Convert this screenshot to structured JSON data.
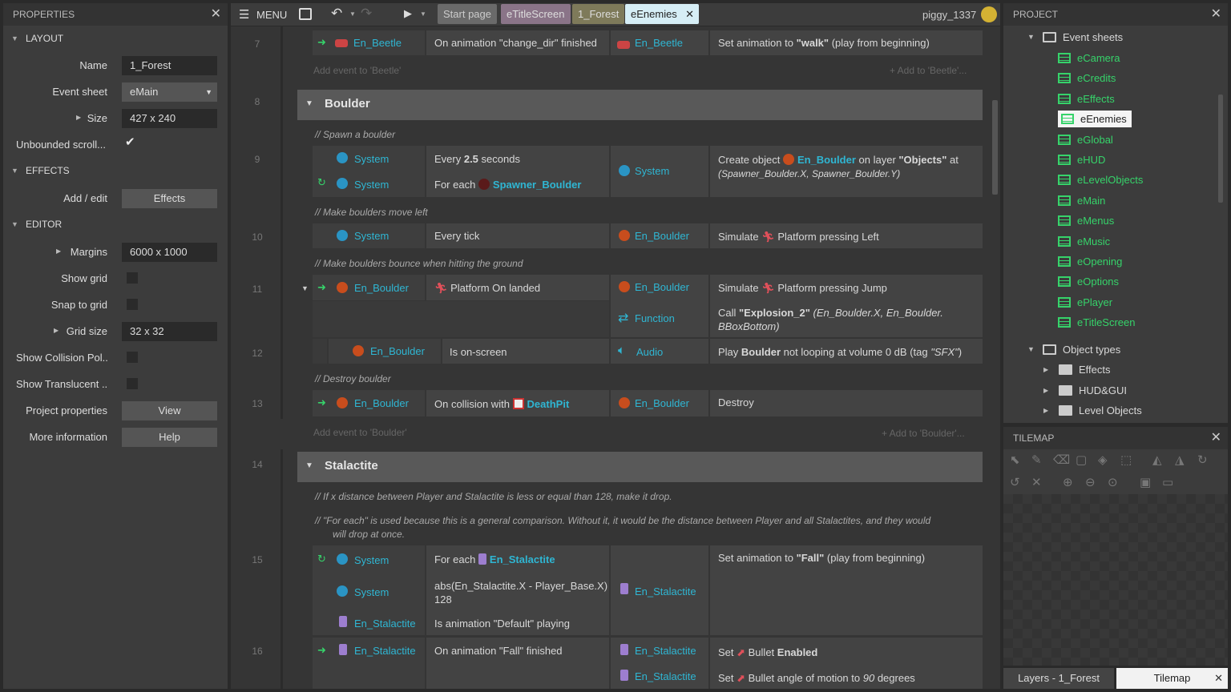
{
  "properties": {
    "title": "PROPERTIES",
    "layout_section": "LAYOUT",
    "effects_section": "EFFECTS",
    "editor_section": "EDITOR",
    "rows": {
      "name_label": "Name",
      "name_value": "1_Forest",
      "eventsheet_label": "Event sheet",
      "eventsheet_value": "eMain",
      "size_label": "Size",
      "size_value": "427 x 240",
      "unbounded_label": "Unbounded scroll...",
      "addedit_label": "Add / edit",
      "effects_btn": "Effects",
      "margins_label": "Margins",
      "margins_value": "6000 x 1000",
      "showgrid_label": "Show grid",
      "snapgrid_label": "Snap to grid",
      "gridsize_label": "Grid size",
      "gridsize_value": "32 x 32",
      "collision_label": "Show Collision Pol...",
      "translucent_label": "Show Translucent ...",
      "projprops_label": "Project properties",
      "view_btn": "View",
      "moreinfo_label": "More information",
      "help_btn": "Help"
    }
  },
  "toolbar": {
    "menu_label": "MENU",
    "tabs": [
      "Start page",
      "eTitleScreen",
      "1_Forest",
      "eEnemies"
    ],
    "username": "piggy_1337"
  },
  "events": {
    "e7": {
      "num": "7",
      "obj": "En_Beetle",
      "cond": "On animation \"change_dir\" finished",
      "aobj": "En_Beetle",
      "act_pre": "Set animation to ",
      "act_b": "\"walk\"",
      "act_post": " (play from beginning)"
    },
    "add_beetle": "Add event to 'Beetle'",
    "add_beetle_r": "+ Add to 'Beetle'...",
    "g8": {
      "num": "8",
      "title": "Boulder"
    },
    "c_spawn": "// Spawn a boulder",
    "e9": {
      "num": "9",
      "sys1": "System",
      "cond1_pre": "Every ",
      "cond1_b": "2.5",
      "cond1_post": " seconds",
      "sys2": "System",
      "cond2_pre": "For each ",
      "cond2_obj": "Spawner_Boulder",
      "aobj": "System",
      "act_pre": "Create object ",
      "act_obj": "En_Boulder",
      "act_mid": " on layer ",
      "act_b": "\"Objects\"",
      "act_post": " at",
      "act_line2": "(Spawner_Boulder.X, Spawner_Boulder.Y)"
    },
    "c_move": "// Make boulders move left",
    "e10": {
      "num": "10",
      "obj": "System",
      "cond": "Every tick",
      "aobj": "En_Boulder",
      "act_pre": "Simulate ",
      "act_post": "Platform pressing Left"
    },
    "c_bounce": "// Make boulders bounce when hitting the ground",
    "e11": {
      "num": "11",
      "obj": "En_Boulder",
      "cond": "Platform On landed",
      "aobj1": "En_Boulder",
      "act1_pre": "Simulate ",
      "act1_post": "Platform pressing Jump",
      "aobj2": "Function",
      "act2_pre": "Call ",
      "act2_b": "\"Explosion_2\"",
      "act2_post": " (En_Boulder.X, En_Boulder.",
      "act2_line2": "BBoxBottom)"
    },
    "e12": {
      "num": "12",
      "obj": "En_Boulder",
      "cond": "Is on-screen",
      "aobj": "Audio",
      "act_pre": "Play ",
      "act_b": "Boulder",
      "act_post": " not looping at volume 0 dB (tag ",
      "act_tag": "\"SFX\"",
      "act_end": ")"
    },
    "c_destroy": "// Destroy boulder",
    "e13": {
      "num": "13",
      "obj": "En_Boulder",
      "cond_pre": "On collision with ",
      "cond_obj": "DeathPit",
      "aobj": "En_Boulder",
      "act": "Destroy"
    },
    "add_boulder": "Add event to 'Boulder'",
    "add_boulder_r": "+ Add to 'Boulder'...",
    "g14": {
      "num": "14",
      "title": "Stalactite"
    },
    "c_stal1": "// If x distance between Player and Stalactite is less or equal than 128, make it drop.",
    "c_stal2a": "// \"For each\" is used because this is a general comparison. Without it, it would be the distance between Player and all Stalactites, and they would",
    "c_stal2b": "will drop at once.",
    "e15": {
      "num": "15",
      "sys1": "System",
      "cond1_pre": "For each ",
      "cond1_obj": "En_Stalactite",
      "sys2": "System",
      "cond2a": "abs(En_Stalactite.X - Player_Base.X) ≤",
      "cond2b": "128",
      "obj3": "En_Stalactite",
      "cond3": "Is animation \"Default\" playing",
      "aobj": "En_Stalactite",
      "act_pre": "Set animation to ",
      "act_b": "\"Fall\"",
      "act_post": " (play from beginning)"
    },
    "e16": {
      "num": "16",
      "obj": "En_Stalactite",
      "cond": "On animation \"Fall\" finished",
      "aobj1": "En_Stalactite",
      "act1_pre": "Set ",
      "act1_mid": "Bullet ",
      "act1_b": "Enabled",
      "aobj2": "En_Stalactite",
      "act2_pre": "Set ",
      "act2_mid": "Bullet angle of motion to ",
      "act2_i": "90",
      "act2_post": " degrees"
    }
  },
  "project": {
    "title": "PROJECT",
    "event_sheets_label": "Event sheets",
    "sheets": [
      "eCamera",
      "eCredits",
      "eEffects",
      "eEnemies",
      "eGlobal",
      "eHUD",
      "eLevelObjects",
      "eMain",
      "eMenus",
      "eMusic",
      "eOpening",
      "eOptions",
      "ePlayer",
      "eTitleScreen"
    ],
    "selected_sheet": "eEnemies",
    "object_types_label": "Object types",
    "folders": [
      "Effects",
      "HUD&GUI",
      "Level Objects"
    ]
  },
  "tilemap": {
    "title": "TILEMAP"
  },
  "bottom_tabs": [
    "Layers - 1_Forest",
    "Tilemap"
  ]
}
